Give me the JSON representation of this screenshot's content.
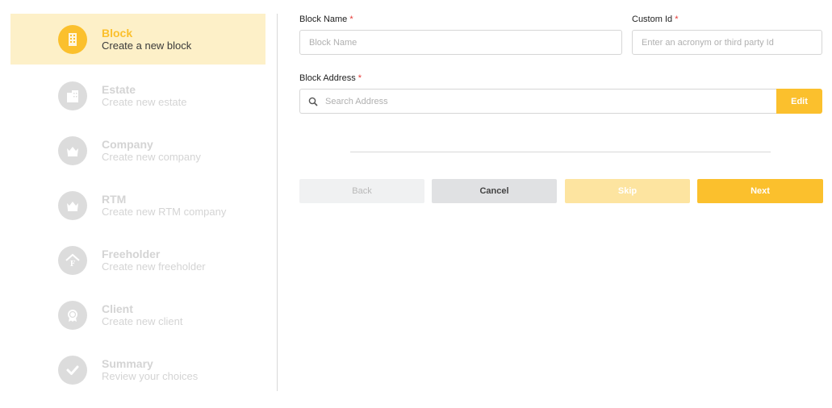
{
  "steps": [
    {
      "icon": "building-icon",
      "title": "Block",
      "subtitle": "Create a new block",
      "active": true
    },
    {
      "icon": "estate-icon",
      "title": "Estate",
      "subtitle": "Create new estate",
      "active": false
    },
    {
      "icon": "crown-icon",
      "title": "Company",
      "subtitle": "Create new company",
      "active": false
    },
    {
      "icon": "crown-icon",
      "title": "RTM",
      "subtitle": "Create new RTM company",
      "active": false
    },
    {
      "icon": "house-f-icon",
      "title": "Freeholder",
      "subtitle": "Create new freeholder",
      "active": false
    },
    {
      "icon": "badge-icon",
      "title": "Client",
      "subtitle": "Create new client",
      "active": false
    },
    {
      "icon": "check-icon",
      "title": "Summary",
      "subtitle": "Review your choices",
      "active": false
    }
  ],
  "form": {
    "block_name_label": "Block Name",
    "block_name_placeholder": "Block Name",
    "custom_id_label": "Custom Id",
    "custom_id_placeholder": "Enter an acronym or third party Id",
    "required_mark": "*",
    "block_address_label": "Block Address",
    "search_placeholder": "Search Address",
    "edit_label": "Edit"
  },
  "buttons": {
    "back": "Back",
    "cancel": "Cancel",
    "skip": "Skip",
    "next": "Next"
  },
  "colors": {
    "accent": "#fbc02d",
    "active_bg": "#fdf0c8",
    "inactive": "#d4d4d4",
    "required": "#e53935"
  }
}
